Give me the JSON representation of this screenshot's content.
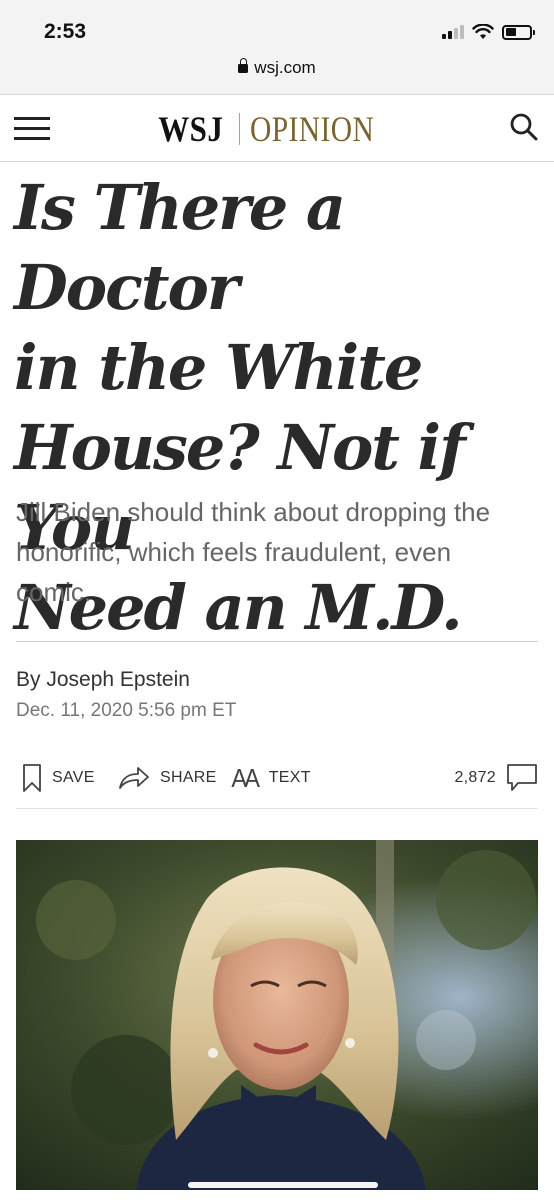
{
  "status_bar": {
    "time": "2:53"
  },
  "browser": {
    "url": "wsj.com"
  },
  "header": {
    "brand": "WSJ",
    "section": "OPINION"
  },
  "article": {
    "headline_lines": [
      "Is There a Doctor",
      "in the White",
      "House? Not if You",
      "Need an M.D."
    ],
    "dek_lines": [
      "Jill Biden should think about dropping the",
      "honorific, which feels fraudulent, even",
      "comic."
    ],
    "byline": "By Joseph Epstein",
    "date": "Dec. 11, 2020 5:56 pm ET"
  },
  "toolbar": {
    "save_label": "SAVE",
    "share_label": "SHARE",
    "text_label": "TEXT",
    "text_icon_glyph": "AA",
    "comment_count": "2,872"
  },
  "icons": [
    "menu-icon",
    "search-icon",
    "bookmark-icon",
    "share-arrow-icon",
    "text-size-icon",
    "comment-icon",
    "lock-icon"
  ],
  "colors": {
    "opinion_gold": "#7a6531",
    "headline": "#2a2a2a",
    "dek": "#666666"
  }
}
